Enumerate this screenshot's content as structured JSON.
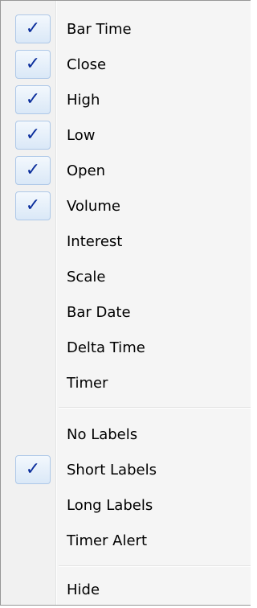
{
  "menu": {
    "group1": [
      {
        "label": "Bar Time",
        "checked": true,
        "check_glyph": "✓"
      },
      {
        "label": "Close",
        "checked": true,
        "check_glyph": "✓"
      },
      {
        "label": "High",
        "checked": true,
        "check_glyph": "✓"
      },
      {
        "label": "Low",
        "checked": true,
        "check_glyph": "✓"
      },
      {
        "label": "Open",
        "checked": true,
        "check_glyph": "✓"
      },
      {
        "label": "Volume",
        "checked": true,
        "check_glyph": "✓"
      },
      {
        "label": "Interest",
        "checked": false
      },
      {
        "label": "Scale",
        "checked": false
      },
      {
        "label": "Bar Date",
        "checked": false
      },
      {
        "label": "Delta Time",
        "checked": false
      },
      {
        "label": "Timer",
        "checked": false
      }
    ],
    "group2": [
      {
        "label": "No Labels",
        "checked": false
      },
      {
        "label": "Short Labels",
        "checked": true,
        "check_glyph": "✓"
      },
      {
        "label": "Long Labels",
        "checked": false
      },
      {
        "label": "Timer Alert",
        "checked": false
      }
    ],
    "group3": [
      {
        "label": "Hide",
        "checked": false
      }
    ]
  },
  "colors": {
    "check": "#0b2e9c",
    "check_border": "#aec8e8",
    "gutter": "#f1f1f1",
    "background": "#f5f5f5"
  }
}
